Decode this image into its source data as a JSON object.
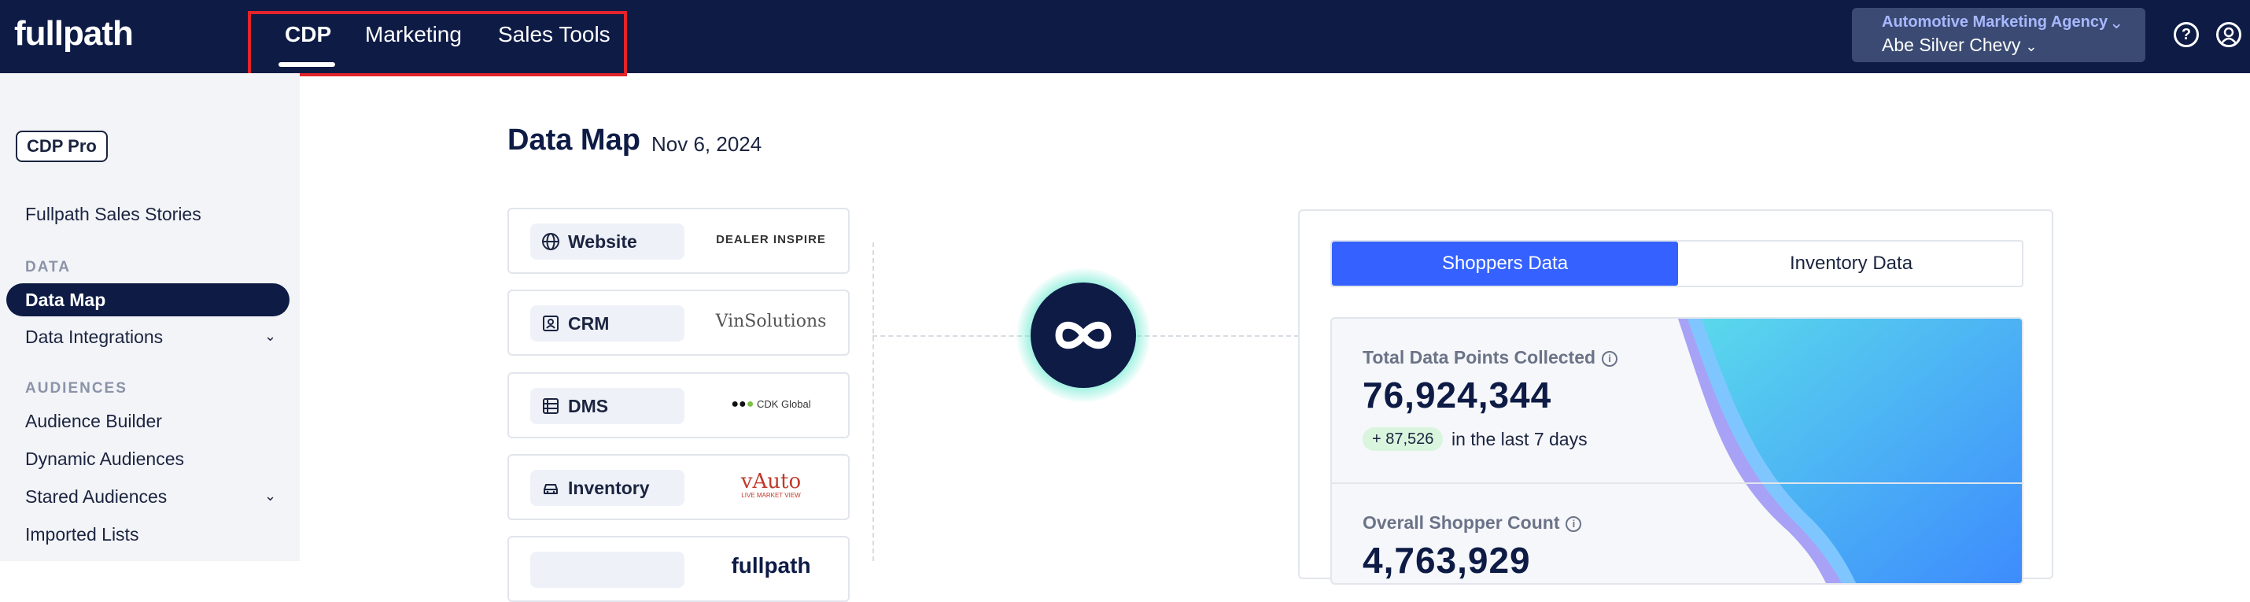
{
  "header": {
    "logo": "fullpath",
    "nav": [
      {
        "label": "CDP",
        "active": true
      },
      {
        "label": "Marketing",
        "active": false
      },
      {
        "label": "Sales Tools",
        "active": false
      }
    ],
    "account": {
      "agency": "Automotive Marketing Agency",
      "dealer": "Abe Silver Chevy"
    },
    "icons": [
      "help-icon",
      "user-icon"
    ]
  },
  "sidebar": {
    "plan_badge": "CDP Pro",
    "top_link": "Fullpath Sales Stories",
    "sections": [
      {
        "title": "DATA",
        "items": [
          {
            "label": "Data Map",
            "active": true
          },
          {
            "label": "Data Integrations",
            "expandable": true
          }
        ]
      },
      {
        "title": "AUDIENCES",
        "items": [
          {
            "label": "Audience Builder"
          },
          {
            "label": "Dynamic Audiences"
          },
          {
            "label": "Stared Audiences",
            "expandable": true
          },
          {
            "label": "Imported Lists"
          }
        ]
      }
    ]
  },
  "main": {
    "title": "Data Map",
    "date": "Nov 6, 2024",
    "sources": [
      {
        "label": "Website",
        "vendor": "DEALER INSPIRE",
        "icon": "globe-icon"
      },
      {
        "label": "CRM",
        "vendor": "VinSolutions",
        "icon": "contact-card-icon"
      },
      {
        "label": "DMS",
        "vendor": "CDK Global",
        "icon": "list-icon"
      },
      {
        "label": "Inventory",
        "vendor": "vAuto",
        "vendor_sub": "LIVE MARKET VIEW",
        "icon": "car-icon"
      },
      {
        "label": "",
        "vendor": "fullpath",
        "icon": ""
      }
    ],
    "hub_icon": "infinity-icon",
    "panel": {
      "tabs": [
        {
          "label": "Shoppers Data",
          "active": true
        },
        {
          "label": "Inventory Data",
          "active": false
        }
      ],
      "stats": [
        {
          "label": "Total Data Points Collected",
          "value": "76,924,344",
          "delta": "+ 87,526",
          "delta_text": "in the last 7 days"
        },
        {
          "label": "Overall Shopper Count",
          "value": "4,763,929"
        }
      ]
    }
  },
  "colors": {
    "navy": "#0d1b45",
    "accent_blue": "#3461ff",
    "highlight_red": "#e3242b",
    "hub_glow": "#5fe8cd",
    "delta_green": "#d9f5dd"
  }
}
